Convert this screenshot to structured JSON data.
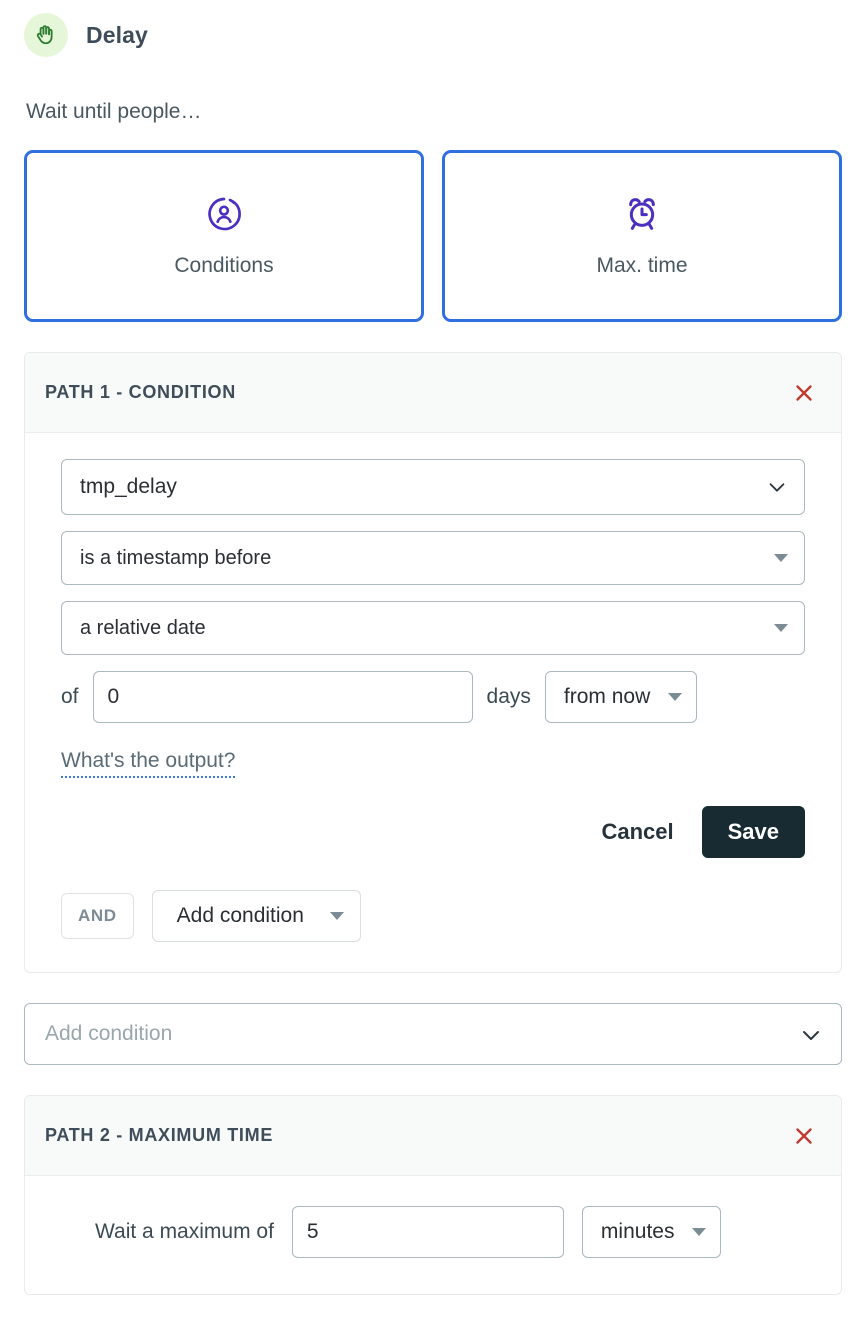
{
  "header": {
    "title": "Delay",
    "icon": "hand-palm-icon",
    "icon_bg": "#e6f7d9",
    "icon_color": "#2e7d32"
  },
  "subtitle": "Wait until people…",
  "cards": [
    {
      "label": "Conditions",
      "icon": "user-circle-icon",
      "selected": true
    },
    {
      "label": "Max. time",
      "icon": "alarm-clock-icon",
      "selected": true
    }
  ],
  "theme": {
    "card_border": "#2f6fe0",
    "icon_purple": "#4b2fc0",
    "close_red": "#bf3b30",
    "save_bg": "#182b33"
  },
  "path1": {
    "title": "PATH 1 - CONDITION",
    "close_icon": "close-icon",
    "field_select": {
      "value": "tmp_delay",
      "icon": "chevron-down-icon"
    },
    "operator_select": {
      "value": "is a timestamp before",
      "icon": "caret-down-icon"
    },
    "date_type_select": {
      "value": "a relative date",
      "icon": "caret-down-icon"
    },
    "relative": {
      "prefix_label": "of",
      "amount": "0",
      "unit_label": "days",
      "direction": "from now",
      "direction_icon": "caret-down-icon"
    },
    "output_link": "What's the output?",
    "cancel_label": "Cancel",
    "save_label": "Save",
    "and_chip": "AND",
    "add_condition_button": "Add condition"
  },
  "add_condition_select": {
    "placeholder": "Add condition",
    "icon": "chevron-down-icon"
  },
  "path2": {
    "title": "PATH 2 - MAXIMUM TIME",
    "close_icon": "close-icon",
    "wait_label": "Wait a maximum of",
    "amount": "5",
    "unit": "minutes",
    "unit_icon": "caret-down-icon"
  }
}
